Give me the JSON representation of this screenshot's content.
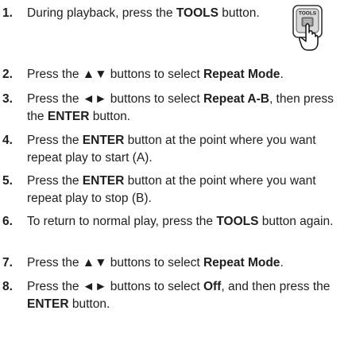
{
  "steps": [
    {
      "num": "1.",
      "parts": [
        {
          "t": "During playback, press the "
        },
        {
          "t": "TOOLS",
          "b": true
        },
        {
          "t": " button."
        }
      ]
    },
    {
      "num": "2.",
      "parts": [
        {
          "t": "Press the "
        },
        {
          "t": "▲▼",
          "b": true
        },
        {
          "t": " buttons to select "
        },
        {
          "t": "Repeat Mode",
          "b": true
        },
        {
          "t": "."
        }
      ]
    },
    {
      "num": "3.",
      "parts": [
        {
          "t": "Press the "
        },
        {
          "t": "◄►",
          "b": true
        },
        {
          "t": " buttons to select "
        },
        {
          "t": "Repeat A-B",
          "b": true
        },
        {
          "t": ", then press the "
        },
        {
          "t": "ENTER",
          "b": true
        },
        {
          "t": " button."
        }
      ]
    },
    {
      "num": "4.",
      "parts": [
        {
          "t": "Press the "
        },
        {
          "t": "ENTER",
          "b": true
        },
        {
          "t": " button at the point where you want repeat play to start (A)."
        }
      ]
    },
    {
      "num": "5.",
      "parts": [
        {
          "t": "Press the "
        },
        {
          "t": "ENTER",
          "b": true
        },
        {
          "t": " button at the point where you want repeat play to stop (B)."
        }
      ]
    },
    {
      "num": "6.",
      "parts": [
        {
          "t": "To return to normal play, press the "
        },
        {
          "t": "TOOLS",
          "b": true
        },
        {
          "t": " button again."
        }
      ]
    },
    {
      "num": "7.",
      "parts": [
        {
          "t": "Press the "
        },
        {
          "t": "▲▼",
          "b": true
        },
        {
          "t": " buttons to select "
        },
        {
          "t": "Repeat Mode",
          "b": true
        },
        {
          "t": "."
        }
      ]
    },
    {
      "num": "8.",
      "parts": [
        {
          "t": "Press the "
        },
        {
          "t": "◄►",
          "b": true
        },
        {
          "t": " buttons to select "
        },
        {
          "t": "Off",
          "b": true
        },
        {
          "t": ", and then press the "
        },
        {
          "t": "ENTER",
          "b": true
        },
        {
          "t": " button."
        }
      ]
    }
  ],
  "tools_icon": {
    "label": "TOOLS",
    "icon": "remote-tools-button-press-icon"
  }
}
